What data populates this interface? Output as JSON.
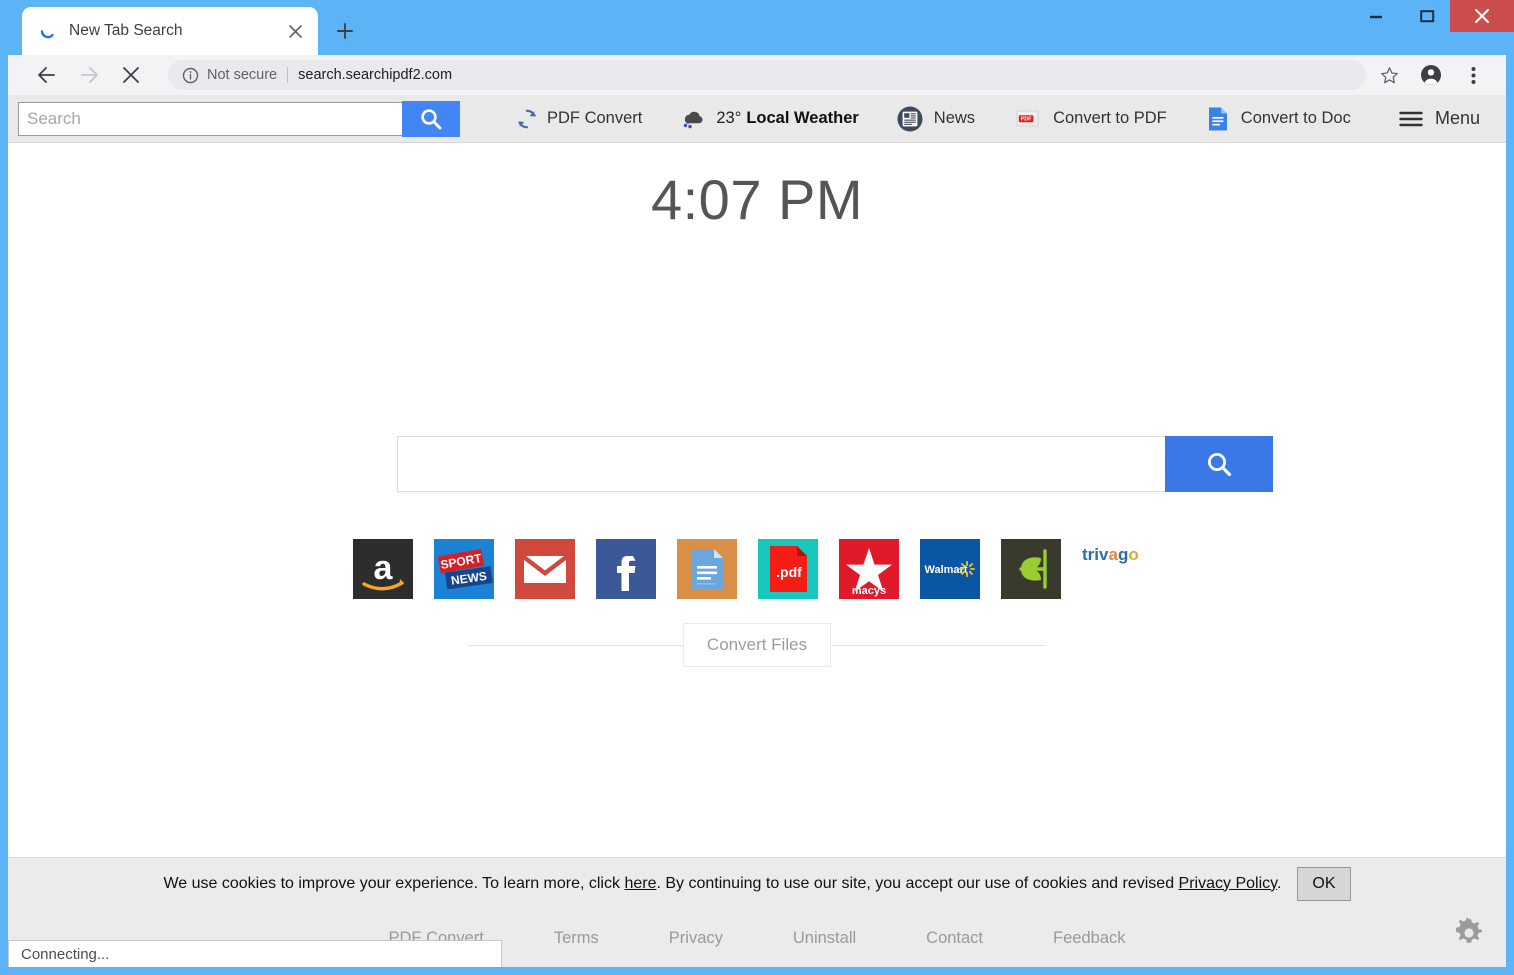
{
  "window": {
    "controls": {
      "minimize": "minimize-button",
      "maximize": "maximize-button",
      "close": "close-button"
    }
  },
  "browser": {
    "tab": {
      "title": "New Tab Search",
      "favicon": "loading-spinner-icon",
      "close_label": "close-tab"
    },
    "new_tab_label": "+",
    "nav": {
      "back": "back-arrow-icon",
      "forward": "forward-arrow-icon",
      "stop": "stop-x-icon"
    },
    "omnibox": {
      "security_text": "Not secure",
      "url": "search.searchipdf2.com",
      "info_icon": "info-circle-icon"
    },
    "actions": {
      "bookmark": "star-icon",
      "profile": "account-avatar-icon",
      "menu": "three-dot-menu-icon"
    },
    "status": "Connecting..."
  },
  "ext_toolbar": {
    "search": {
      "value": "",
      "placeholder": "Search",
      "button_icon": "search-icon"
    },
    "items": [
      {
        "label": "PDF Convert",
        "icon": "pdf-convert-refresh-icon"
      },
      {
        "label": "Local Weather",
        "temp": "23°",
        "icon": "snow-cloud-icon"
      },
      {
        "label": "News",
        "icon": "newspaper-icon"
      },
      {
        "label": "Convert to PDF",
        "icon": "pdf-file-icon"
      },
      {
        "label": "Convert to Doc",
        "icon": "doc-file-icon"
      },
      {
        "label": "Menu",
        "icon": "hamburger-menu-icon"
      }
    ]
  },
  "page": {
    "clock": "4:07 PM",
    "search": {
      "value": "",
      "placeholder": "",
      "button_icon": "search-icon"
    },
    "tiles": [
      {
        "name": "amazon",
        "label": "a"
      },
      {
        "name": "sport-news",
        "label": "SPORT NEWS"
      },
      {
        "name": "gmail",
        "label": ""
      },
      {
        "name": "facebook",
        "label": "f"
      },
      {
        "name": "documents",
        "label": ""
      },
      {
        "name": "pdf",
        "label": ".pdf"
      },
      {
        "name": "macys",
        "label": "macys"
      },
      {
        "name": "walmart",
        "label": "Walmart"
      },
      {
        "name": "iherb",
        "label": ""
      },
      {
        "name": "trivago",
        "label": "trivago"
      }
    ],
    "convert_files_label": "Convert Files",
    "cookie": {
      "text_before_here": "We use cookies to improve your experience. To learn more, click ",
      "here_link": "here",
      "text_middle": ". By continuing to use our site, you accept our use of cookies and revised ",
      "privacy_link": "Privacy Policy",
      "text_end": ".",
      "ok_label": "OK"
    },
    "footer_links": [
      "PDF Convert",
      "Terms",
      "Privacy",
      "Uninstall",
      "Contact",
      "Feedback"
    ],
    "settings_icon": "gear-icon"
  },
  "colors": {
    "window_frame": "#5cb3f5",
    "accent_blue": "#4285f4",
    "main_search_blue": "#3b78e7",
    "close_red": "#cb4d4d",
    "toolbar_gray": "#e9e9e9"
  }
}
